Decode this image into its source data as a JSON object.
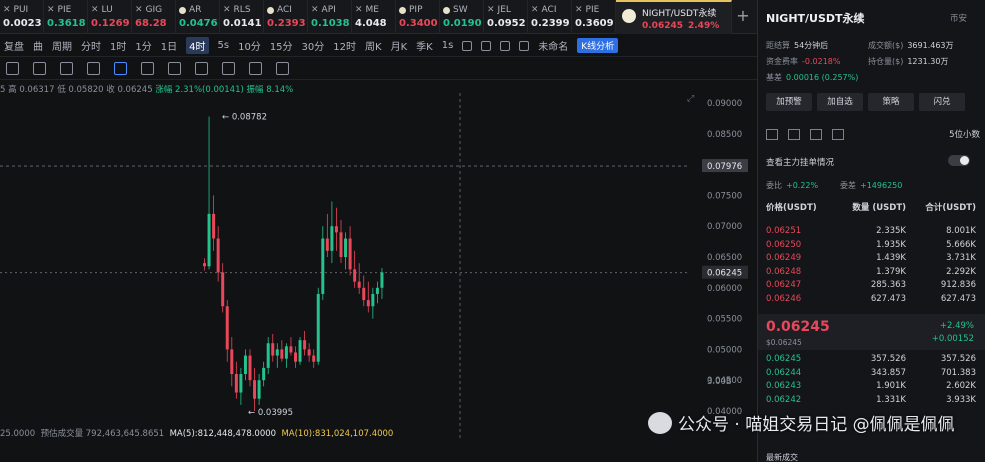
{
  "tickers": [
    {
      "name": "PUI",
      "value": "0.0023",
      "color": "#e8eaef",
      "icon": "close-icon"
    },
    {
      "name": "PIE",
      "value": "0.3618",
      "color": "#24c28c",
      "icon": "close-icon"
    },
    {
      "name": "LU",
      "value": "0.1269",
      "color": "#e8485a",
      "icon": "close-icon"
    },
    {
      "name": "GIG",
      "value": "68.28",
      "color": "#e8485a",
      "icon": "close-icon"
    },
    {
      "name": "AR",
      "value": "0.0476",
      "color": "#24c28c",
      "icon": "coin-icon"
    },
    {
      "name": "RLS",
      "value": "0.0141",
      "color": "#e8eaef",
      "icon": "close-icon"
    },
    {
      "name": "ACI",
      "value": "0.2393",
      "color": "#e8485a",
      "icon": "coin-icon"
    },
    {
      "name": "API",
      "value": "0.1038",
      "color": "#24c28c",
      "icon": "close-icon"
    },
    {
      "name": "ME",
      "value": "4.048",
      "color": "#e8eaef",
      "icon": "close-icon"
    },
    {
      "name": "PIP",
      "value": "0.3400",
      "color": "#e8485a",
      "icon": "coin-icon"
    },
    {
      "name": "SW",
      "value": "0.0190",
      "color": "#24c28c",
      "icon": "coin-icon"
    },
    {
      "name": "JEL",
      "value": "0.0952",
      "color": "#e8eaef",
      "icon": "close-icon"
    },
    {
      "name": "ACI",
      "value": "0.2399",
      "color": "#e8eaef",
      "icon": "close-icon"
    },
    {
      "name": "PIE",
      "value": "0.3609",
      "color": "#e8eaef",
      "icon": "close-icon"
    }
  ],
  "active_ticker": {
    "name": "NIGHT/USDT永续",
    "price": "0.06245",
    "change": "2.49%"
  },
  "toolbar": [
    "复盘",
    "曲",
    "周期",
    "分时",
    "1时",
    "1分",
    "1日",
    "4时",
    "5s",
    "10分",
    "15分",
    "30分",
    "12时",
    "周K",
    "月K",
    "季K",
    "1s",
    "未命名",
    "K线分析"
  ],
  "ohlc": {
    "high": "高 0.06317",
    "low": "低 0.05820",
    "close": "收 0.06245",
    "amp": "涨幅 2.31%(0.00141)",
    "range": "振幅 8.14%"
  },
  "axis": [
    "0.09000",
    "0.08500",
    "0.08000",
    "0.07500",
    "0.07000",
    "0.06500",
    "0.06000",
    "0.05500",
    "0.05000",
    "0.04500",
    "0.04000"
  ],
  "max_label": "0.08782",
  "min_label": "0.03995",
  "cross_label": "0.07976",
  "last_label": "0.06245",
  "vol_label": "3.00B",
  "bottom": {
    "vol": "25.0000",
    "vol_ma": "预估成交量 792,463,645.8651",
    "ma5": "MA(5):812,448,478.0000",
    "ma10": "MA(10):831,024,107.4000"
  },
  "panel": {
    "title": "NIGHT/USDT永续",
    "tag": "币安",
    "stats": [
      {
        "k": "距结算",
        "v": "54分钟后"
      },
      {
        "k": "成交额($)",
        "v": "3691.463万"
      },
      {
        "k": "资金费率",
        "v": "-0.0218%"
      },
      {
        "k": "持仓量($)",
        "v": "1231.30万"
      },
      {
        "k": "基差",
        "v": "0.00016 (0.257%)"
      }
    ],
    "buttons": [
      "加预警",
      "加自选",
      "策略",
      "闪兑"
    ],
    "precision": "5位小数",
    "big_orders": "查看主力挂单情况",
    "ratio": {
      "buy": "+0.22%",
      "diff": "+1496250",
      "buy_k": "委比",
      "diff_k": "委差"
    },
    "headers": [
      "价格(USDT)",
      "数量 (USDT)",
      "合计(USDT)"
    ],
    "asks": [
      [
        "0.06251",
        "2.335K",
        "8.001K"
      ],
      [
        "0.06250",
        "1.935K",
        "5.666K"
      ],
      [
        "0.06249",
        "1.439K",
        "3.731K"
      ],
      [
        "0.06248",
        "1.379K",
        "2.292K"
      ],
      [
        "0.06247",
        "285.363",
        "912.836"
      ],
      [
        "0.06246",
        "627.473",
        "627.473"
      ]
    ],
    "last": {
      "price": "0.06245",
      "usd": "$0.06245",
      "pct": "+2.49%",
      "chg": "+0.00152"
    },
    "bids": [
      [
        "0.06245",
        "357.526",
        "357.526"
      ],
      [
        "0.06244",
        "343.857",
        "701.383"
      ],
      [
        "0.06243",
        "1.901K",
        "2.602K"
      ],
      [
        "0.06242",
        "1.331K",
        "3.933K"
      ]
    ],
    "footer": "最新成交"
  },
  "watermark": "公众号 · 喵姐交易日记 @佩佩是佩佩",
  "chart_data": {
    "type": "candlestick",
    "ylim": [
      0.04,
      0.09
    ],
    "candles": [
      [
        0.064,
        0.0648,
        0.0628,
        0.0635
      ],
      [
        0.0635,
        0.0878,
        0.063,
        0.072
      ],
      [
        0.072,
        0.075,
        0.066,
        0.068
      ],
      [
        0.068,
        0.07,
        0.061,
        0.0625
      ],
      [
        0.0625,
        0.064,
        0.056,
        0.057
      ],
      [
        0.057,
        0.058,
        0.048,
        0.05
      ],
      [
        0.05,
        0.052,
        0.044,
        0.046
      ],
      [
        0.046,
        0.048,
        0.042,
        0.043
      ],
      [
        0.043,
        0.047,
        0.041,
        0.046
      ],
      [
        0.046,
        0.05,
        0.045,
        0.049
      ],
      [
        0.049,
        0.05,
        0.044,
        0.045
      ],
      [
        0.045,
        0.047,
        0.04,
        0.042
      ],
      [
        0.042,
        0.046,
        0.041,
        0.045
      ],
      [
        0.045,
        0.048,
        0.044,
        0.047
      ],
      [
        0.047,
        0.052,
        0.046,
        0.051
      ],
      [
        0.051,
        0.0525,
        0.048,
        0.049
      ],
      [
        0.049,
        0.051,
        0.047,
        0.05
      ],
      [
        0.05,
        0.0515,
        0.048,
        0.0485
      ],
      [
        0.0485,
        0.051,
        0.047,
        0.0505
      ],
      [
        0.0505,
        0.052,
        0.049,
        0.0495
      ],
      [
        0.0495,
        0.0505,
        0.047,
        0.048
      ],
      [
        0.048,
        0.052,
        0.0475,
        0.0515
      ],
      [
        0.0515,
        0.053,
        0.049,
        0.05
      ],
      [
        0.05,
        0.051,
        0.048,
        0.049
      ],
      [
        0.049,
        0.05,
        0.047,
        0.048
      ],
      [
        0.048,
        0.06,
        0.0475,
        0.059
      ],
      [
        0.059,
        0.07,
        0.058,
        0.068
      ],
      [
        0.068,
        0.072,
        0.065,
        0.066
      ],
      [
        0.066,
        0.074,
        0.064,
        0.07
      ],
      [
        0.07,
        0.073,
        0.066,
        0.069
      ],
      [
        0.069,
        0.071,
        0.064,
        0.065
      ],
      [
        0.065,
        0.069,
        0.063,
        0.068
      ],
      [
        0.068,
        0.07,
        0.062,
        0.063
      ],
      [
        0.063,
        0.066,
        0.06,
        0.061
      ],
      [
        0.061,
        0.064,
        0.059,
        0.06
      ],
      [
        0.06,
        0.062,
        0.057,
        0.058
      ],
      [
        0.058,
        0.061,
        0.056,
        0.057
      ],
      [
        0.057,
        0.06,
        0.055,
        0.059
      ],
      [
        0.059,
        0.061,
        0.0575,
        0.06
      ],
      [
        0.06,
        0.0632,
        0.0582,
        0.0625
      ]
    ]
  }
}
